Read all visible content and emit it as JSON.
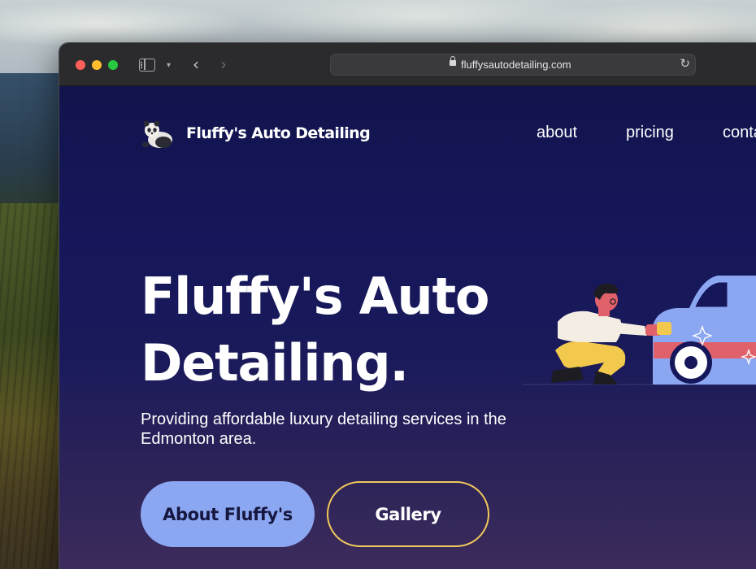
{
  "browser": {
    "url": "fluffysautodetailing.com"
  },
  "nav": {
    "brand": "Fluffy's Auto Detailing",
    "links": [
      "about",
      "pricing",
      "conta"
    ]
  },
  "hero": {
    "title": "Fluffy's Auto Detailing.",
    "subtitle": "Providing affordable luxury detailing services in the Edmonton area."
  },
  "buttons": {
    "primary_label": "About Fluffy's",
    "secondary_label": "Gallery"
  },
  "colors": {
    "page_background": "#14165a",
    "primary_button": "#8ca7f2",
    "secondary_button_border": "#f1c85a",
    "car_body": "#8ca7f2",
    "car_stripe": "#e0616a"
  },
  "icons": {
    "logo": "panda-logo-icon",
    "lock": "lock-icon",
    "reload": "reload-icon",
    "back": "chevron-left-icon",
    "forward": "chevron-right-icon",
    "sidebar": "sidebar-icon"
  }
}
